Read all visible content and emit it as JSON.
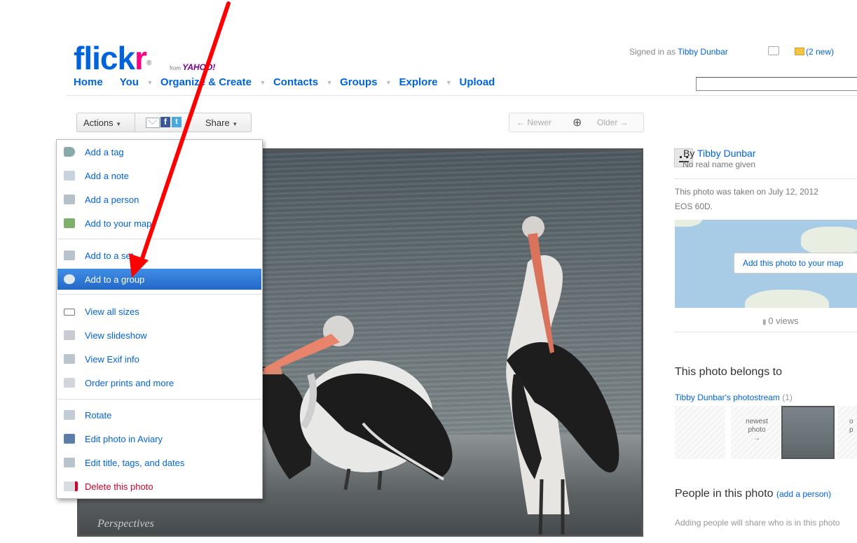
{
  "header": {
    "logo_main": "flick",
    "logo_r": "r",
    "logo_reg": "®",
    "from_text": "from",
    "yahoo_text": "YAHOO!",
    "signed_in_prefix": "Signed in as ",
    "user_name": "Tibby Dunbar",
    "mail_label": "(2 new)"
  },
  "nav": {
    "items": [
      "Home",
      "You",
      "Organize & Create",
      "Contacts",
      "Groups",
      "Explore",
      "Upload"
    ],
    "dropdown_glyph": "▼"
  },
  "toolbar": {
    "actions_label": "Actions",
    "actions_caret": "▼",
    "share_label": "Share",
    "share_caret": "▼",
    "fb_glyph": "f",
    "tw_glyph": "t",
    "newer_label": "← Newer",
    "zoom_glyph": "⊕",
    "older_label": "Older →"
  },
  "photo": {
    "watermark": "Perspectives"
  },
  "actions_menu": {
    "items": [
      {
        "label": "Add a tag",
        "icon": "tag-icon"
      },
      {
        "label": "Add a note",
        "icon": "note-icon"
      },
      {
        "label": "Add a person",
        "icon": "person-icon"
      },
      {
        "label": "Add to your map",
        "icon": "map-icon"
      },
      {
        "label": "Add to a set",
        "icon": "set-icon"
      },
      {
        "label": "Add to a group",
        "icon": "group-icon",
        "selected": true
      },
      {
        "label": "View all sizes",
        "icon": "sizes-icon"
      },
      {
        "label": "View slideshow",
        "icon": "slideshow-icon"
      },
      {
        "label": "View Exif info",
        "icon": "exif-icon"
      },
      {
        "label": "Order prints and more",
        "icon": "prints-icon"
      },
      {
        "label": "Rotate",
        "icon": "rotate-icon"
      },
      {
        "label": "Edit photo in Aviary",
        "icon": "edit-icon"
      },
      {
        "label": "Edit title, tags, and dates",
        "icon": "edit-title-icon"
      },
      {
        "label": "Delete this photo",
        "icon": "delete-icon"
      }
    ]
  },
  "sidebar": {
    "by_prefix": "By ",
    "owner": "Tibby Dunbar",
    "real_name": "No real name given",
    "taken_line1": "This photo was taken on July 12, 2012",
    "taken_line2": "EOS 60D.",
    "map_button": "Add this photo to your map",
    "views": "0 views",
    "belongs_title": "This photo belongs to",
    "stream_name": "Tibby Dunbar's photostream",
    "stream_count": "(1)",
    "newest_label": "newest photo",
    "newest_arrow": "→",
    "older_label_a": "o",
    "older_label_b": "p",
    "people_title": "People in this photo",
    "people_link": "(add a person)",
    "adding_text": "Adding people will share who is in this photo"
  },
  "colors": {
    "flickr_blue": "#0063dc",
    "flickr_pink": "#ff0084",
    "menu_selected": "#2a6fd0",
    "annotation_arrow": "#ff0000"
  }
}
